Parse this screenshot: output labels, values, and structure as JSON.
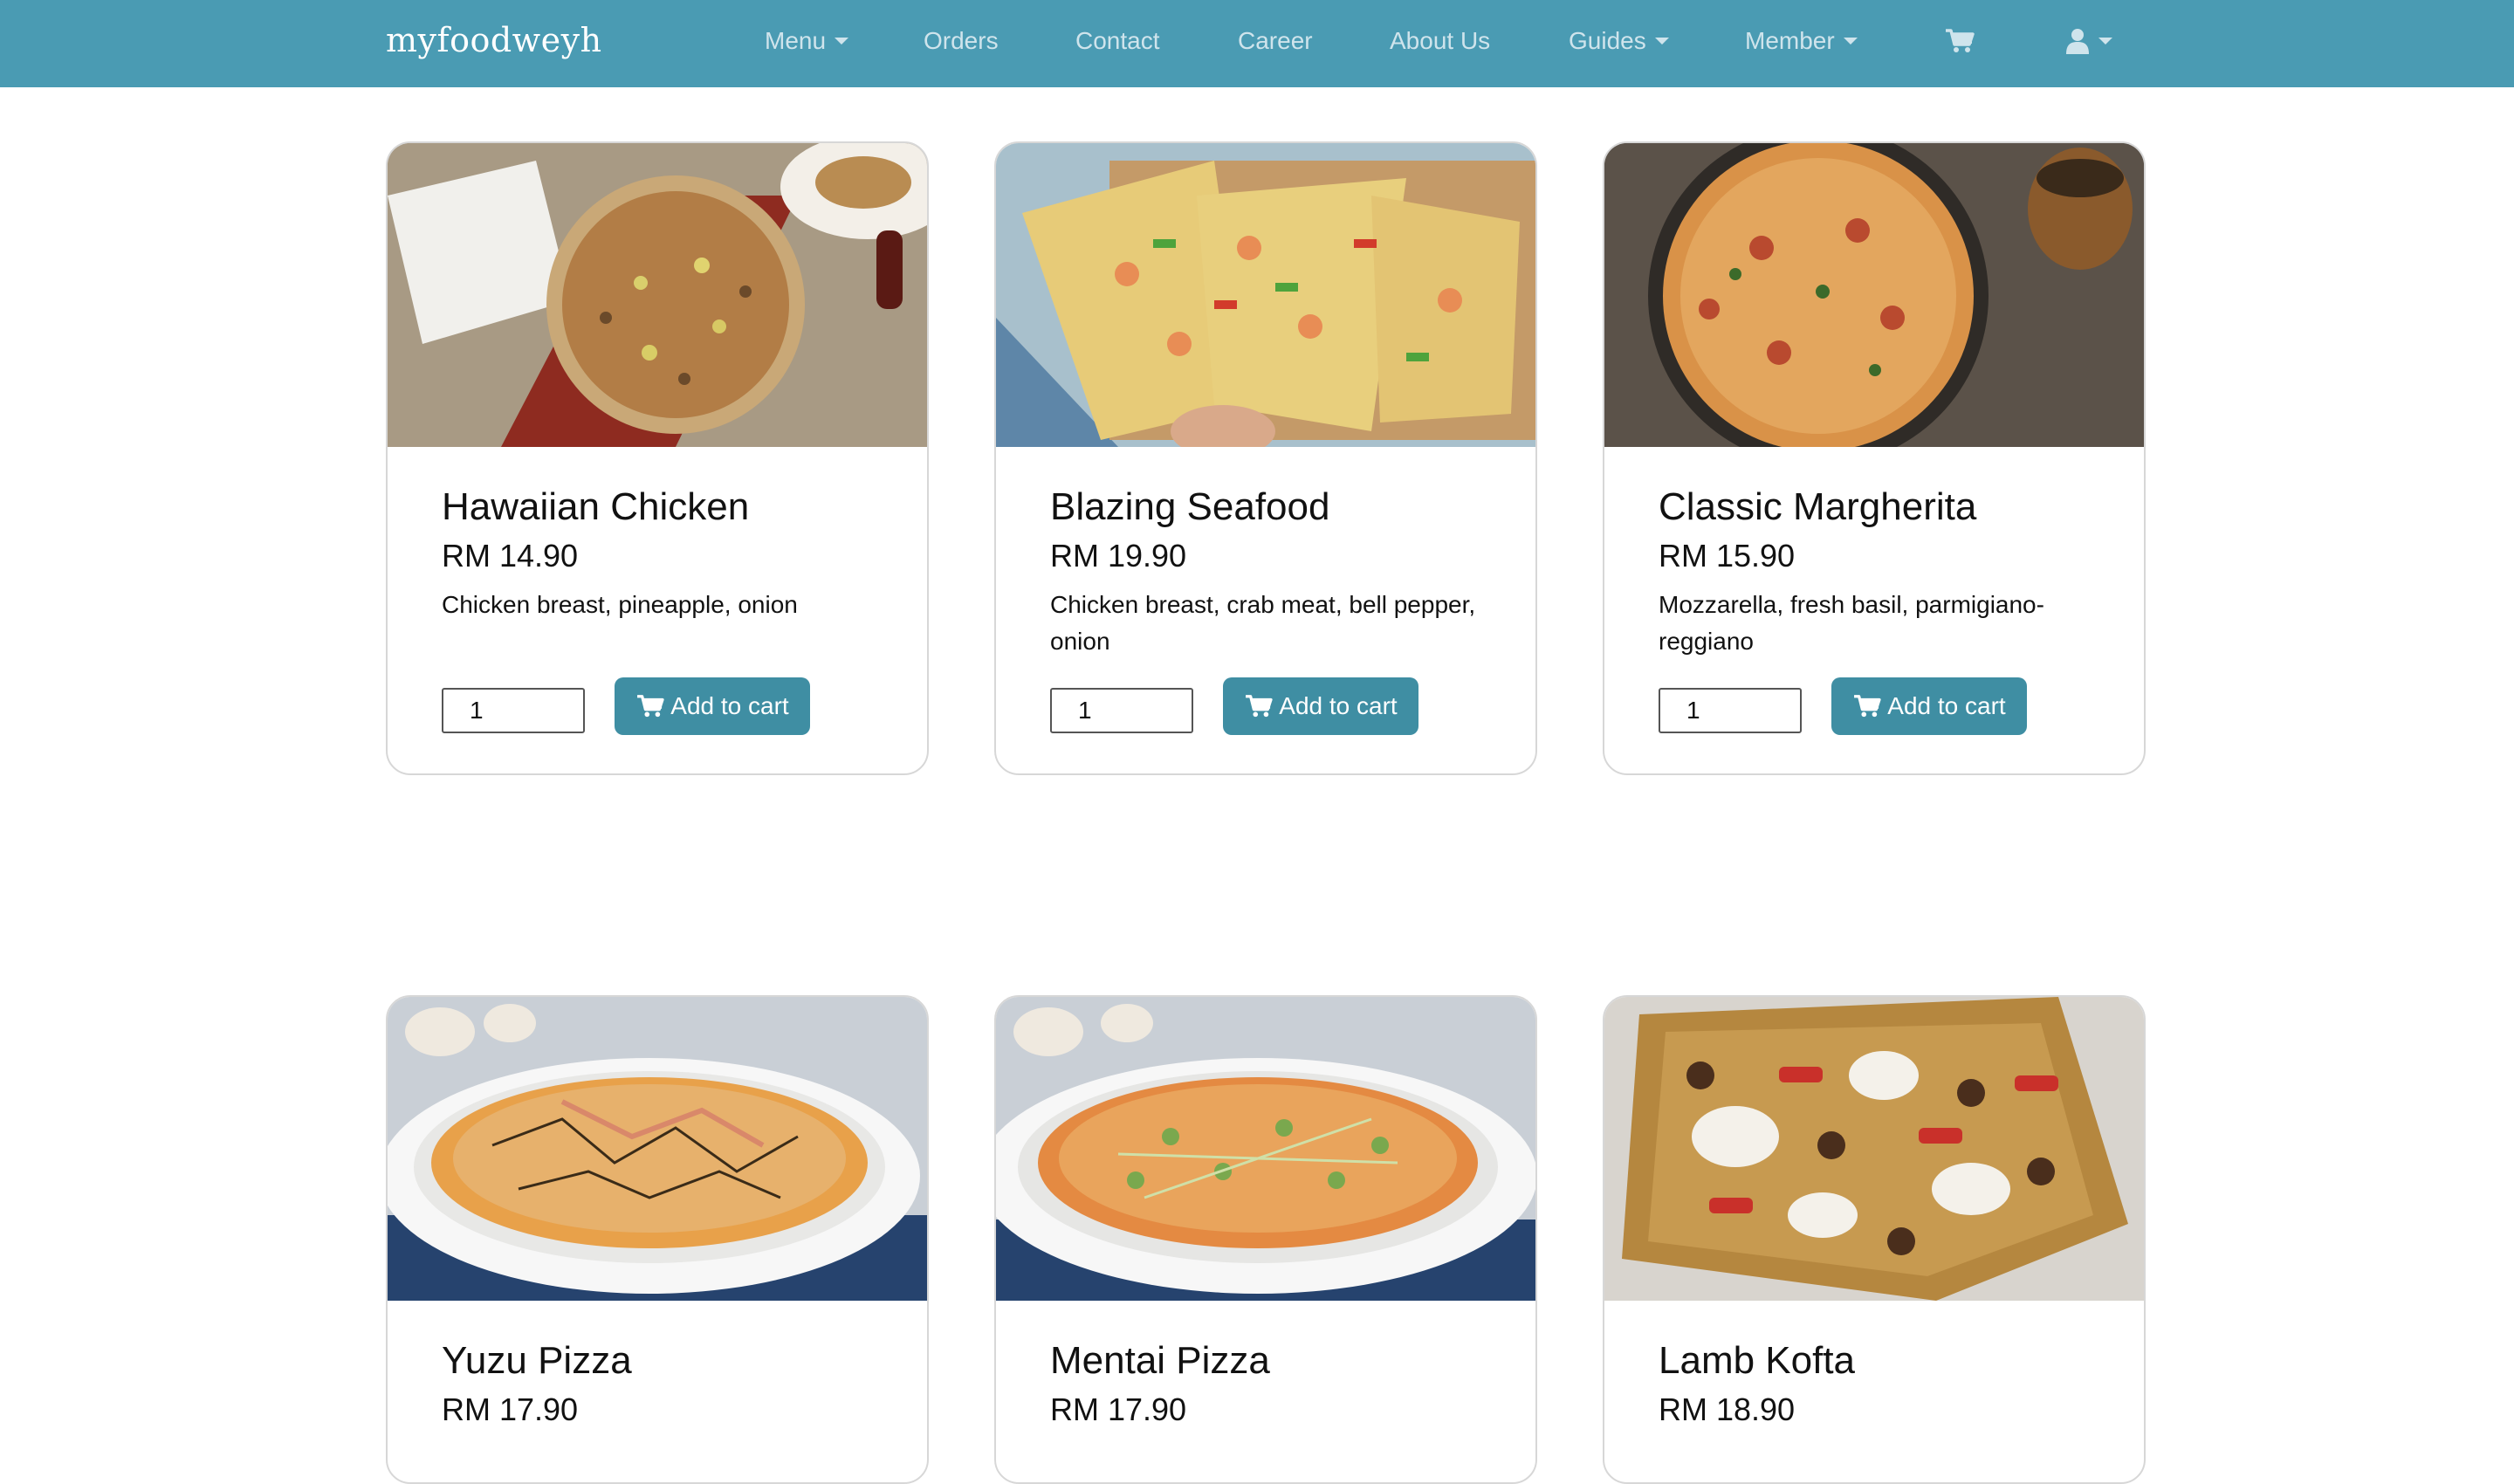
{
  "header": {
    "brand": "myfoodweyh",
    "nav": [
      {
        "label": "Menu",
        "dropdown": true
      },
      {
        "label": "Orders",
        "dropdown": false
      },
      {
        "label": "Contact",
        "dropdown": false
      },
      {
        "label": "Career",
        "dropdown": false
      },
      {
        "label": "About Us",
        "dropdown": false
      },
      {
        "label": "Guides",
        "dropdown": true
      },
      {
        "label": "Member",
        "dropdown": true
      }
    ],
    "cart_icon": "shopping-cart-icon",
    "user_icon": "user-icon",
    "colors": {
      "bar": "#4a9bb3",
      "link": "#cfe4ec",
      "brand": "#ffffff"
    }
  },
  "products": [
    {
      "name": "Hawaiian Chicken",
      "price": "RM 14.90",
      "description": "Chicken breast, pineapple, onion",
      "quantity": "1",
      "button_label": "Add to cart",
      "image": "hawaiian-chicken-pizza-photo"
    },
    {
      "name": "Blazing Seafood",
      "price": "RM 19.90",
      "description": "Chicken breast, crab meat, bell pepper, onion",
      "quantity": "1",
      "button_label": "Add to cart",
      "image": "blazing-seafood-pizza-photo"
    },
    {
      "name": "Classic Margherita",
      "price": "RM 15.90",
      "description": "Mozzarella, fresh basil, parmigiano-reggiano",
      "quantity": "1",
      "button_label": "Add to cart",
      "image": "classic-margherita-pizza-photo"
    },
    {
      "name": "Yuzu Pizza",
      "price": "RM 17.90",
      "image": "yuzu-pizza-photo"
    },
    {
      "name": "Mentai Pizza",
      "price": "RM 17.90",
      "image": "mentai-pizza-photo"
    },
    {
      "name": "Lamb Kofta",
      "price": "RM 18.90",
      "image": "lamb-kofta-pizza-photo"
    }
  ],
  "button_color": "#3f8ea3"
}
